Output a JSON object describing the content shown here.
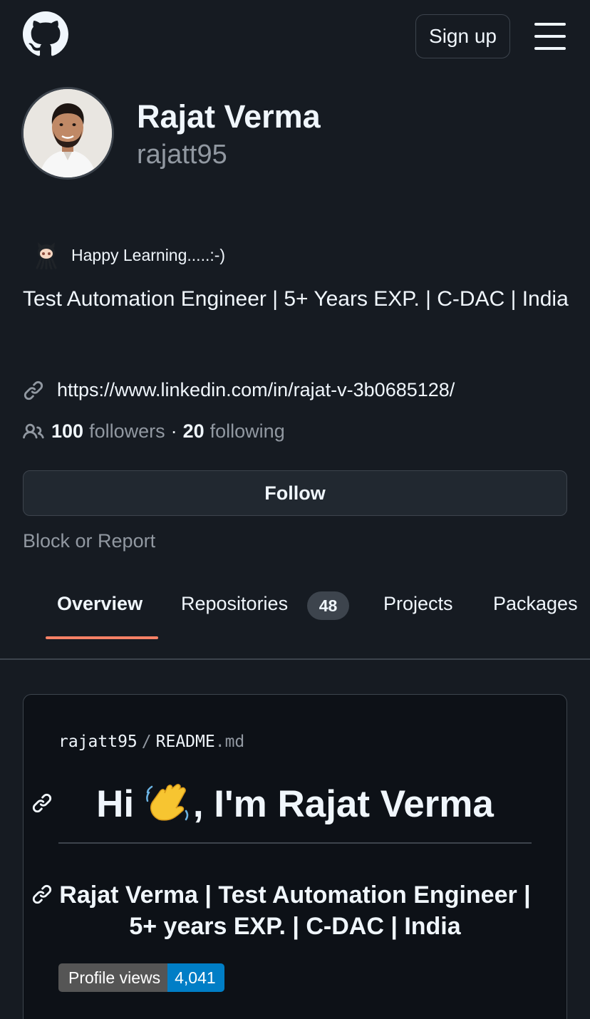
{
  "header": {
    "logo_icon": "github-mark-icon",
    "signup_label": "Sign up",
    "menu_icon": "hamburger-menu-icon"
  },
  "profile": {
    "name": "Rajat Verma",
    "login": "rajatt95",
    "status_emoji": "octocat-icon",
    "status_text": "Happy Learning.....:-)",
    "bio": "Test Automation Engineer | 5+ Years EXP. | C-DAC | India",
    "website": "https://www.linkedin.com/in/rajat-v-3b0685128/",
    "followers_count": "100",
    "followers_label": "followers",
    "separator": "·",
    "following_count": "20",
    "following_label": "following",
    "follow_button": "Follow",
    "block_report": "Block or Report"
  },
  "tabs": [
    {
      "label": "Overview",
      "active": true
    },
    {
      "label": "Repositories",
      "counter": "48"
    },
    {
      "label": "Projects"
    },
    {
      "label": "Packages"
    }
  ],
  "readme": {
    "path_user": "rajatt95",
    "path_sep": "/",
    "path_file": "README",
    "path_ext": ".md",
    "heading_pre": "Hi ",
    "heading_post": ", I'm Rajat Verma",
    "heading_emoji": "waving-hand-icon",
    "subheading": "Rajat Verma | Test Automation Engineer | 5+ years EXP. | C-DAC | India",
    "badge_label": "Profile views",
    "badge_value": "4,041"
  },
  "colors": {
    "background": "#161b22",
    "accent_underline": "#f78166",
    "badge_value_bg": "#007ec6"
  }
}
